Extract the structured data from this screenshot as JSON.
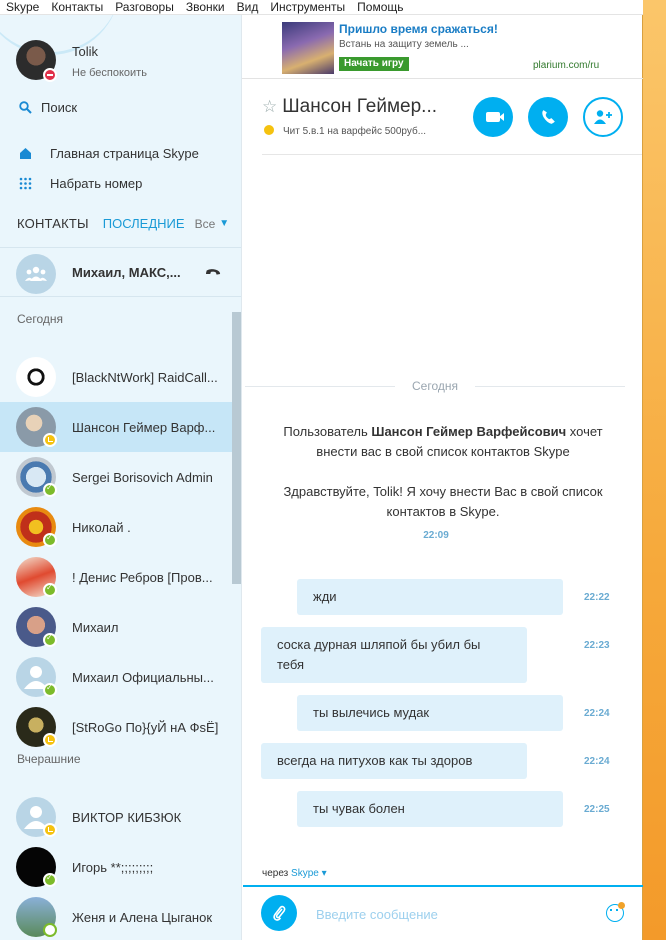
{
  "menubar": [
    "Skype",
    "Контакты",
    "Разговоры",
    "Звонки",
    "Вид",
    "Инструменты",
    "Помощь"
  ],
  "profile": {
    "name": "Tolik",
    "status": "Не беспокоить"
  },
  "nav": {
    "search": "Поиск",
    "home": "Главная страница Skype",
    "dial": "Набрать номер"
  },
  "tabs": {
    "contacts": "КОНТАКТЫ",
    "recent": "ПОСЛЕДНИЕ",
    "filter": "Все"
  },
  "group": {
    "name": "Михаил, МАКС,..."
  },
  "sections": {
    "today": "Сегодня",
    "yesterday": "Вчерашние"
  },
  "contacts": [
    {
      "name": "[BlackNtWork] RaidCall...",
      "status": "none"
    },
    {
      "name": "Шансон Геймер Варф...",
      "status": "away"
    },
    {
      "name": "Sergei Borisovich Admin",
      "status": "online"
    },
    {
      "name": "Николай .",
      "status": "online"
    },
    {
      "name": "! Денис Ребров [Пров...",
      "status": "online"
    },
    {
      "name": "Михаил",
      "status": "online"
    },
    {
      "name": "Михаил Официальны...",
      "status": "online"
    },
    {
      "name": "[StRoGo По}{уЙ нА ФsЁ]",
      "status": "away"
    },
    {
      "name": "ВИКТОР КИБЗЮК",
      "status": "away"
    },
    {
      "name": "Игорь **;;;;;;;;;",
      "status": "online"
    },
    {
      "name": "Женя и Алена Цыганок",
      "status": "offline"
    }
  ],
  "ad": {
    "title": "Пришло время сражаться!",
    "subtitle": "Встань на защиту земель ...",
    "button": "Начать игру",
    "url": "plarium.com/ru"
  },
  "chat": {
    "title": "Шансон Геймер...",
    "mood": "Чит 5.в.1 на варфейс 500руб..."
  },
  "conversation": {
    "day": "Сегодня",
    "system": {
      "line1a": "Пользователь ",
      "name": "Шансон Геймер Варфейсович",
      "line1b": " хочет",
      "line2": "внести вас в свой список контактов Skype",
      "greeting1": "Здравствуйте, Tolik! Я хочу внести Вас в свой список",
      "greeting2": "контактов в Skype.",
      "time": "22:09"
    },
    "messages": [
      {
        "text": "жди",
        "time": "22:22"
      },
      {
        "text1": "соска дурная шляпой бы убил бы",
        "text2": "тебя",
        "time": "22:23"
      },
      {
        "text": "ты вылечись мудак",
        "time": "22:24"
      },
      {
        "text": "всегда на питухов как ты здоров",
        "time": "22:24"
      },
      {
        "text": "ты чувак болен",
        "time": "22:25"
      }
    ]
  },
  "composer": {
    "via": "через ",
    "via_app": "Skype",
    "placeholder": "Введите сообщение"
  },
  "colors": {
    "accent": "#00aff0",
    "online": "#7cbb2a",
    "away": "#f5c20f",
    "dnd": "#e0304a"
  }
}
